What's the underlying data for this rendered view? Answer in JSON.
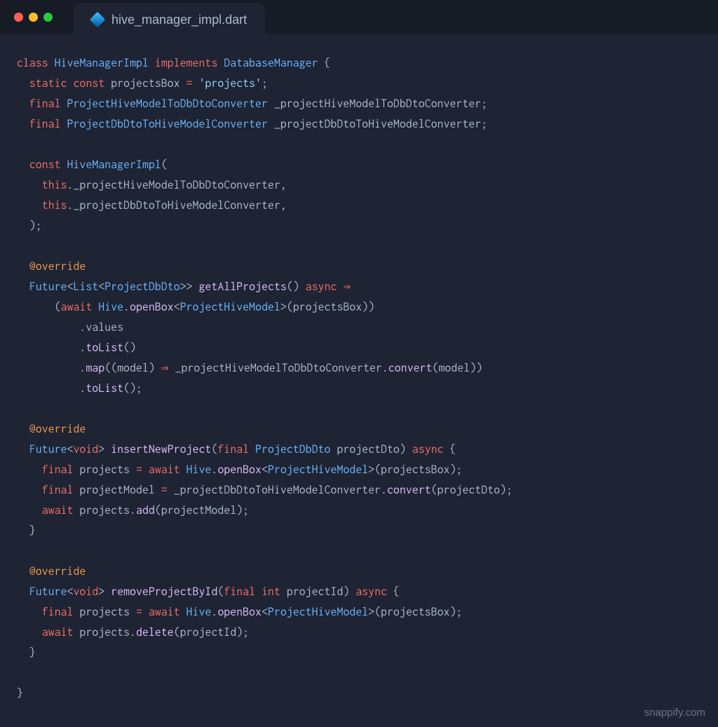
{
  "tab": {
    "filename": "hive_manager_impl.dart"
  },
  "watermark": "snappify.com",
  "code": {
    "l1": {
      "t1": "class",
      "t2": "HiveManagerImpl",
      "t3": "implements",
      "t4": "DatabaseManager",
      "t5": " {"
    },
    "l2": {
      "t1": "static",
      "t2": "const",
      "t3": " projectsBox ",
      "t4": "=",
      "t5": "'projects'",
      "t6": ";"
    },
    "l3": {
      "t1": "final",
      "t2": "ProjectHiveModelToDbDtoConverter",
      "t3": " _projectHiveModelToDbDtoConverter;"
    },
    "l4": {
      "t1": "final",
      "t2": "ProjectDbDtoToHiveModelConverter",
      "t3": " _projectDbDtoToHiveModelConverter;"
    },
    "l5": {
      "t1": "const",
      "t2": "HiveManagerImpl",
      "t3": "("
    },
    "l6": {
      "t1": "this",
      "t2": "._projectHiveModelToDbDtoConverter,"
    },
    "l7": {
      "t1": "this",
      "t2": "._projectDbDtoToHiveModelConverter,"
    },
    "l8": {
      "t1": "  );"
    },
    "l9": {
      "t1": "@override"
    },
    "l10": {
      "t1": "Future",
      "t2": "<",
      "t3": "List",
      "t4": "<",
      "t5": "ProjectDbDto",
      "t6": ">>",
      "t7": "getAllProjects",
      "t8": "()",
      "t9": "async",
      "t10": "⇒"
    },
    "l11": {
      "t1": "      (",
      "t2": "await",
      "t3": "Hive",
      "t4": ".",
      "t5": "openBox",
      "t6": "<",
      "t7": "ProjectHiveModel",
      "t8": ">",
      "t9": "(projectsBox))"
    },
    "l12": {
      "t1": "          .values"
    },
    "l13": {
      "t1": "          .",
      "t2": "toList",
      "t3": "()"
    },
    "l14": {
      "t1": "          .",
      "t2": "map",
      "t3": "((model) ",
      "t4": "⇒",
      "t5": " _projectHiveModelToDbDtoConverter.",
      "t6": "convert",
      "t7": "(model))"
    },
    "l15": {
      "t1": "          .",
      "t2": "toList",
      "t3": "();"
    },
    "l16": {
      "t1": "@override"
    },
    "l17": {
      "t1": "Future",
      "t2": "<",
      "t3": "void",
      "t4": ">",
      "t5": "insertNewProject",
      "t6": "(",
      "t7": "final",
      "t8": "ProjectDbDto",
      "t9": " projectDto)",
      "t10": "async",
      "t11": " {"
    },
    "l18": {
      "t1": "final",
      "t2": " projects ",
      "t3": "=",
      "t4": "await",
      "t5": "Hive",
      "t6": ".",
      "t7": "openBox",
      "t8": "<",
      "t9": "ProjectHiveModel",
      "t10": ">",
      "t11": "(projectsBox);"
    },
    "l19": {
      "t1": "final",
      "t2": " projectModel ",
      "t3": "=",
      "t4": " _projectDbDtoToHiveModelConverter.",
      "t5": "convert",
      "t6": "(projectDto);"
    },
    "l20": {
      "t1": "await",
      "t2": " projects.",
      "t3": "add",
      "t4": "(projectModel);"
    },
    "l21": {
      "t1": "  }"
    },
    "l22": {
      "t1": "@override"
    },
    "l23": {
      "t1": "Future",
      "t2": "<",
      "t3": "void",
      "t4": ">",
      "t5": "removeProjectById",
      "t6": "(",
      "t7": "final",
      "t8": "int",
      "t9": " projectId)",
      "t10": "async",
      "t11": " {"
    },
    "l24": {
      "t1": "final",
      "t2": " projects ",
      "t3": "=",
      "t4": "await",
      "t5": "Hive",
      "t6": ".",
      "t7": "openBox",
      "t8": "<",
      "t9": "ProjectHiveModel",
      "t10": ">",
      "t11": "(projectsBox);"
    },
    "l25": {
      "t1": "await",
      "t2": " projects.",
      "t3": "delete",
      "t4": "(projectId);"
    },
    "l26": {
      "t1": "  }"
    },
    "l27": {
      "t1": "}"
    }
  }
}
